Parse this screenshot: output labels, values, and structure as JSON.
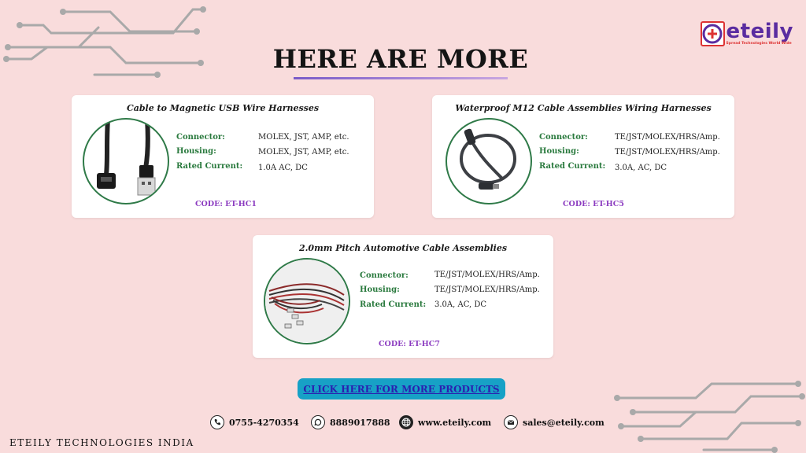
{
  "brand": {
    "name": "eteily",
    "tagline": "Spread Technologies World Wide",
    "colors": {
      "primary": "#5a2ca0",
      "accent": "#dd3333"
    }
  },
  "heading": "HERE ARE MORE",
  "labels": {
    "connector": "Connector:",
    "housing": "Housing:",
    "rated_current": "Rated Current:"
  },
  "products": [
    {
      "title": "Cable to Magnetic USB Wire Harnesses",
      "connector": "MOLEX, JST, AMP, etc.",
      "housing": "MOLEX, JST, AMP, etc.",
      "rated_current": "1.0A AC, DC",
      "code": "CODE: ET-HC1",
      "image": "usb-cable-image"
    },
    {
      "title": "Waterproof M12 Cable Assemblies Wiring Harnesses",
      "connector": "TE/JST/MOLEX/HRS/Amp.",
      "housing": "TE/JST/MOLEX/HRS/Amp.",
      "rated_current": "3.0A, AC, DC",
      "code": "CODE: ET-HC5",
      "image": "m12-cable-image"
    },
    {
      "title": "2.0mm Pitch Automotive Cable Assemblies",
      "connector": "TE/JST/MOLEX/HRS/Amp.",
      "housing": "TE/JST/MOLEX/HRS/Amp.",
      "rated_current": "3.0A, AC, DC",
      "code": "CODE: ET-HC7",
      "image": "automotive-cable-image"
    }
  ],
  "cta": {
    "label": "CLICK HERE FOR MORE PRODUCTS",
    "color": "#17a1c6"
  },
  "contacts": [
    {
      "icon": "phone-icon",
      "text": "0755-4270354"
    },
    {
      "icon": "whatsapp-icon",
      "text": "8889017888"
    },
    {
      "icon": "globe-icon",
      "text": "www.eteily.com"
    },
    {
      "icon": "mail-icon",
      "text": "sales@eteily.com"
    }
  ],
  "footer": "ETEILY TECHNOLOGIES INDIA"
}
